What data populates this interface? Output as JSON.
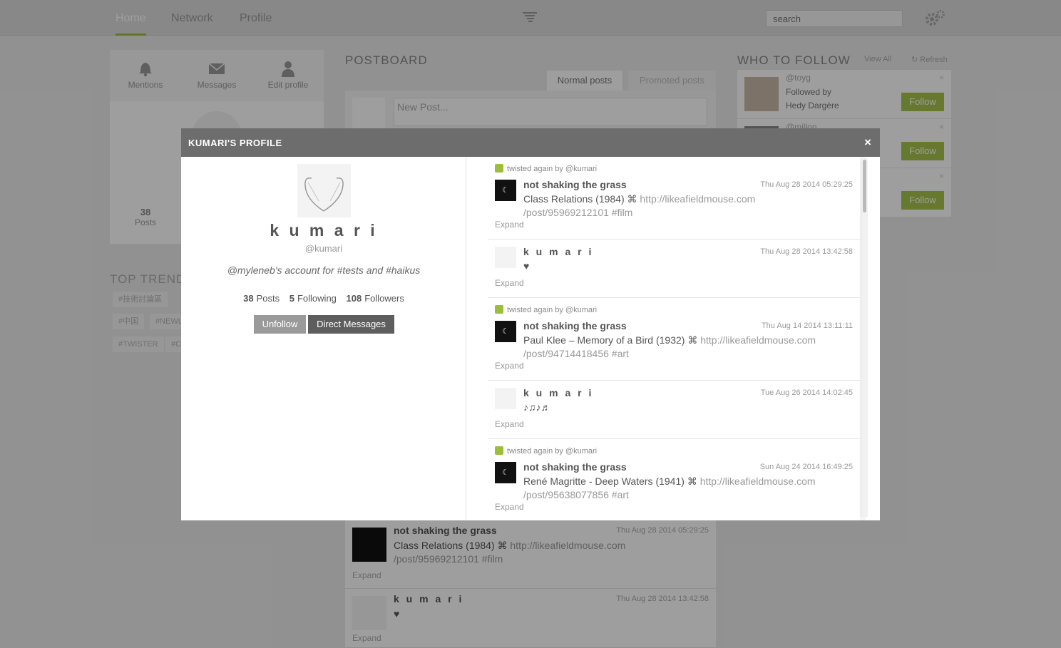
{
  "colors": {
    "accent": "#9bbf3d",
    "modal_header": "#6d6d6d",
    "unfollow_button": "#9a9a9a",
    "dm_button": "#5e5e5e",
    "follow_button": "#a6c44c"
  },
  "nav": {
    "tabs": [
      {
        "label": "Home"
      },
      {
        "label": "Network"
      },
      {
        "label": "Profile"
      }
    ],
    "search_placeholder": "search"
  },
  "left": {
    "tabs": [
      {
        "label": "Mentions",
        "icon": "bell-icon"
      },
      {
        "label": "Messages",
        "icon": "envelope-icon"
      },
      {
        "label": "Edit profile",
        "icon": "person-icon"
      }
    ],
    "posts_count": "38",
    "posts_label": "Posts",
    "trends_title": "TOP TRENDS",
    "trends": [
      "#技術討論區",
      "#中国",
      "#NEWL",
      "#TWISTER",
      "#C"
    ]
  },
  "postboard": {
    "title": "POSTBOARD",
    "tabs": [
      "Normal posts",
      "Promoted posts"
    ],
    "new_post_placeholder": "New Post...",
    "posts": [
      {
        "name": "not shaking the grass",
        "time": "Thu Aug 28 2014 05:29:25",
        "text": "Class Relations (1984) ⌘ ",
        "link": "http://likeafieldmouse.com",
        "rest": "/post/95969212101 #film",
        "expand": "Expand"
      },
      {
        "name": "k u m a r i",
        "time": "Thu Aug 28 2014 13:42:58",
        "text": "♥",
        "expand": "Expand"
      }
    ]
  },
  "who_to_follow": {
    "title": "WHO TO FOLLOW",
    "view_all": "View All",
    "refresh": "Refresh",
    "items": [
      {
        "user": "@toyg",
        "by_label": "Followed by",
        "by": "Hedy Dargère",
        "follow": "Follow"
      },
      {
        "user": "@millon",
        "follow": "Follow"
      },
      {
        "follow": "Follow"
      }
    ]
  },
  "modal": {
    "title": "KUMARI'S PROFILE",
    "close": "×",
    "profile": {
      "name": "k u m a r i",
      "handle": "@kumari",
      "bio": "@myleneb's account for #tests and #haikus",
      "posts": "38",
      "posts_label": "Posts",
      "following": "5",
      "following_label": "Following",
      "followers": "108",
      "followers_label": "Followers",
      "unfollow": "Unfollow",
      "dm": "Direct Messages"
    },
    "feed": [
      {
        "retwist": "twisted again by @kumari",
        "name": "not shaking the grass",
        "time": "Thu Aug 28 2014 05:29:25",
        "text": "Class Relations (1984) ⌘ ",
        "link": "http://likeafieldmouse.com",
        "rest": "/post/95969212101 #film",
        "expand": "Expand"
      },
      {
        "name": "k u m a r i",
        "time": "Thu Aug 28 2014 13:42:58",
        "text": "♥",
        "expand": "Expand"
      },
      {
        "retwist": "twisted again by @kumari",
        "name": "not shaking the grass",
        "time": "Thu Aug 14 2014 13:11:11",
        "text": "Paul Klee – Memory of a Bird (1932) ⌘ ",
        "link": "http://likeafieldmouse.com",
        "rest": "/post/94714418456 #art",
        "expand": "Expand"
      },
      {
        "name": "k u m a r i",
        "time": "Tue Aug 26 2014 14:02:45",
        "text": "♪♫♪♬",
        "expand": "Expand"
      },
      {
        "retwist": "twisted again by @kumari",
        "name": "not shaking the grass",
        "time": "Sun Aug 24 2014 16:49:25",
        "text": "René Magritte - Deep Waters (1941) ⌘ ",
        "link": "http://likeafieldmouse.com",
        "rest": "/post/95638077856 #art",
        "expand": "Expand"
      }
    ]
  }
}
